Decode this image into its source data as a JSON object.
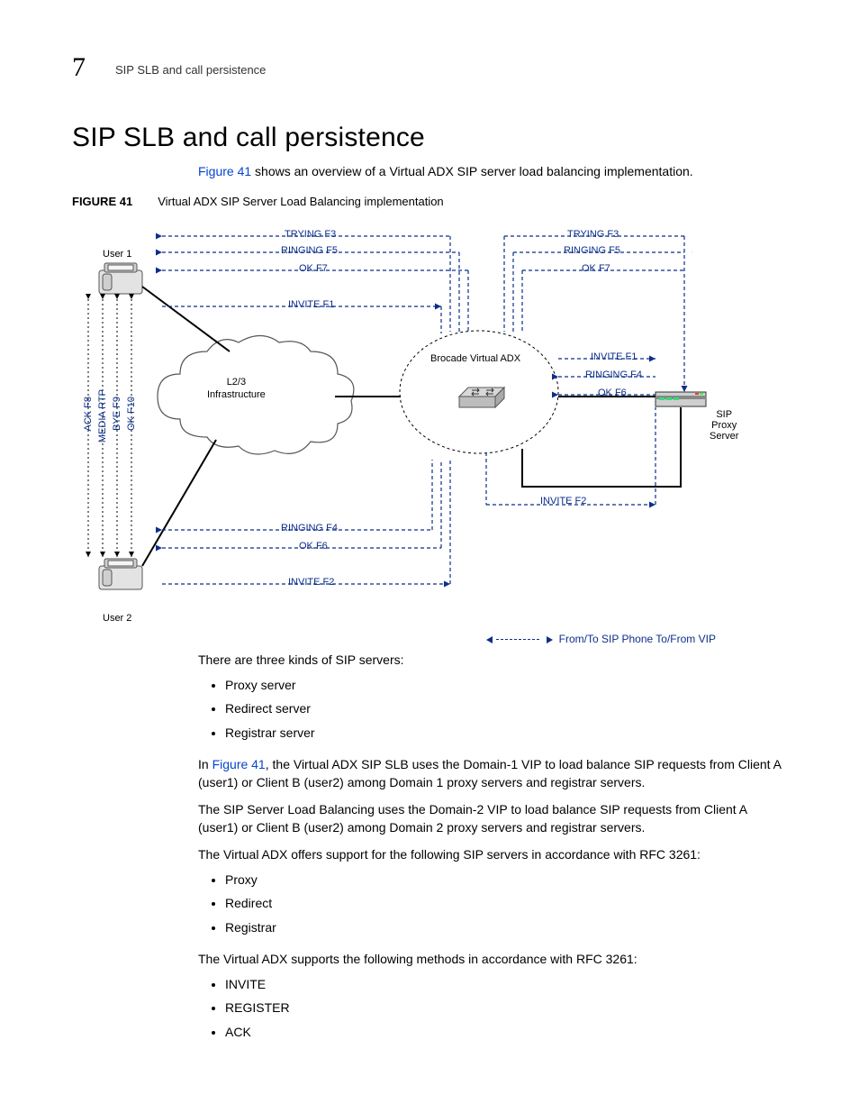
{
  "header": {
    "chapter_number": "7",
    "running_head": "SIP SLB and call persistence"
  },
  "title": "SIP SLB and call persistence",
  "intro": {
    "figref": "Figure 41",
    "rest": " shows an overview of a Virtual ADX SIP server load balancing implementation."
  },
  "figure": {
    "label": "FIGURE 41",
    "caption": "Virtual ADX SIP Server Load Balancing implementation",
    "nodes": {
      "user1": "User 1",
      "user2": "User 2",
      "cloud": "L2/3\nInfrastructure",
      "adx": "Brocade Virtual ADX",
      "proxy": "SIP\nProxy\nServer"
    },
    "flows_top_left": [
      "TRYING F3",
      "RINGING F5",
      "OK F7",
      "INVITE F1"
    ],
    "flows_top_right": [
      "TRYING F3",
      "RINGING F5",
      "OK F7"
    ],
    "flows_mid_right": [
      "INVITE F1",
      "RINGING F4",
      "OK F6"
    ],
    "flows_bottom_right": [
      "INVITE F2"
    ],
    "flows_bottom_left": [
      "RINGING F4",
      "OK F6",
      "INVITE F2"
    ],
    "flows_vertical": [
      "ACK F8",
      "MEDIA RTP",
      "BYE F9",
      "OK F10"
    ],
    "legend": "From/To SIP Phone To/From VIP"
  },
  "body": {
    "p1": "There are three kinds of SIP servers:",
    "list1": [
      "Proxy server",
      "Redirect server",
      "Registrar server"
    ],
    "p2a": "In ",
    "p2ref": "Figure 41",
    "p2b": ", the Virtual ADX SIP SLB uses the Domain-1 VIP to load balance SIP requests from Client A (user1) or Client B (user2) among Domain 1 proxy servers and registrar servers.",
    "p3": "The SIP Server Load Balancing uses the Domain-2 VIP to load balance SIP requests from Client A (user1) or Client B (user2) among Domain 2 proxy servers and registrar servers.",
    "p4": "The Virtual ADX offers support for the following SIP servers in accordance with RFC 3261:",
    "list2": [
      "Proxy",
      "Redirect",
      "Registrar"
    ],
    "p5": "The Virtual ADX supports the following methods in accordance with RFC 3261:",
    "list3": [
      "INVITE",
      "REGISTER",
      "ACK"
    ]
  }
}
